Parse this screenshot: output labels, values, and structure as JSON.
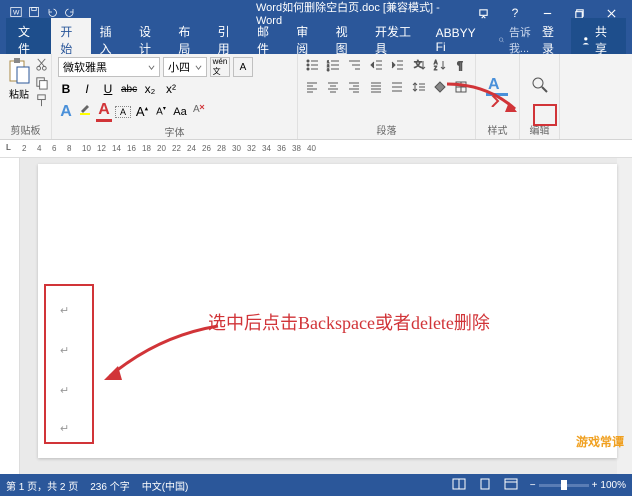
{
  "app": {
    "title": "Word如何删除空白页.doc [兼容模式] - Word"
  },
  "win": {
    "help": "?",
    "min": "–",
    "restore": "❐",
    "close": "✕"
  },
  "tabs": {
    "file": "文件",
    "home": "开始",
    "insert": "插入",
    "design": "设计",
    "layout": "布局",
    "references": "引用",
    "mailings": "邮件",
    "review": "审阅",
    "view": "视图",
    "developer": "开发工具",
    "abbyy": "ABBYY Fi"
  },
  "tell": "告诉我...",
  "signin": "登录",
  "share": "共享",
  "clipboard": {
    "paste": "粘贴",
    "label": "剪贴板"
  },
  "font": {
    "name": "微软雅黑",
    "size": "小四",
    "bold": "B",
    "italic": "I",
    "underline": "U",
    "strike": "abc",
    "sub": "x₂",
    "sup": "x²",
    "label": "字体"
  },
  "paragraph": {
    "label": "段落"
  },
  "styles": {
    "label": "样式"
  },
  "edit": {
    "label": "编辑"
  },
  "ruler": {
    "l": "L",
    "marks": [
      "2",
      "4",
      "6",
      "8",
      "10",
      "12",
      "14",
      "16",
      "18",
      "20",
      "22",
      "24",
      "26",
      "28",
      "30",
      "32",
      "34",
      "36",
      "38",
      "40"
    ]
  },
  "doc": {
    "instruction": "选中后点击Backspace或者delete删除"
  },
  "status": {
    "page": "第 1 页，共 2 页",
    "words": "236 个字",
    "lang": "中文(中国)",
    "zoom": "100%"
  },
  "watermark": "游戏常谭"
}
